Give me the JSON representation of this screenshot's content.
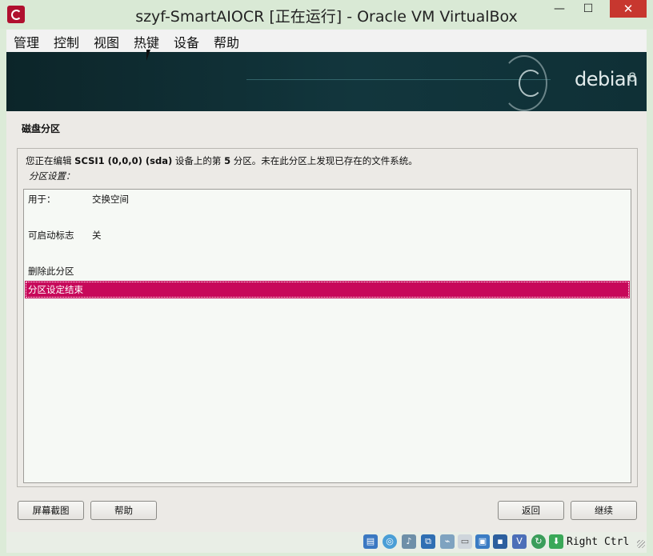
{
  "window": {
    "title": "szyf-SmartAIOCR [正在运行] - Oracle VM VirtualBox",
    "min_glyph": "—",
    "max_glyph": "☐",
    "close_glyph": "✕"
  },
  "menu": [
    "管理",
    "控制",
    "视图",
    "热键",
    "设备",
    "帮助"
  ],
  "banner": {
    "brand": "debian",
    "version": "8"
  },
  "installer": {
    "section_title": "磁盘分区",
    "info_prefix": "您正在编辑 ",
    "info_device": "SCSI1 (0,0,0) (sda)",
    "info_mid": " 设备上的第 ",
    "info_number": "5",
    "info_suffix": " 分区。未在此分区上发现已存在的文件系统。",
    "settings_label": "分区设置：",
    "rows": [
      {
        "key": "用于：",
        "value": "交换空间"
      },
      {
        "key": "可启动标志",
        "value": "关"
      },
      {
        "key": "删除此分区",
        "value": ""
      },
      {
        "key": "分区设定结束",
        "value": ""
      }
    ],
    "buttons": {
      "screenshot": "屏幕截图",
      "help": "帮助",
      "back": "返回",
      "continue": "继续"
    }
  },
  "status": {
    "host_key": "Right Ctrl",
    "icons": [
      "hard-disk-icon",
      "optical-drive-icon",
      "audio-icon",
      "network-icon",
      "usb-icon",
      "shared-folders-icon",
      "display-icon",
      "video-capture-icon",
      "virtualization-icon",
      "mouse-integration-icon",
      "keyboard-capture-icon"
    ]
  },
  "colors": {
    "accent": "#c7085a",
    "close": "#c7372f",
    "banner": "#12363d"
  }
}
